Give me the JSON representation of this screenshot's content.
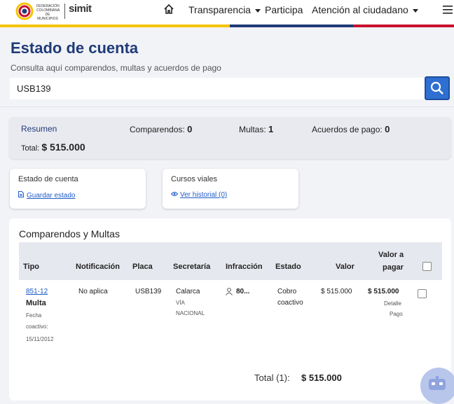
{
  "header": {
    "logo_text": "FEDERACIÓN COLOMBIANA DE MUNICIPIOS",
    "logo_simit": "simit",
    "nav": [
      "Transparencia",
      "Participa",
      "Atención al ciudadano"
    ],
    "flag_colors": [
      "#f5c400",
      "#1f3b78",
      "#c8102e"
    ]
  },
  "page": {
    "title": "Estado de cuenta",
    "subtitle": "Consulta aquí comparendos, multas y acuerdos de pago",
    "search_value": "USB139"
  },
  "summary": {
    "label": "Resumen",
    "comparendos_label": "Comparendos:",
    "comparendos_value": "0",
    "multas_label": "Multas:",
    "multas_value": "1",
    "acuerdos_label": "Acuerdos de pago:",
    "acuerdos_value": "0",
    "total_label": "Total:",
    "total_value": "$ 515.000"
  },
  "cards": [
    {
      "title": "Estado de cuenta",
      "link": "Guardar estado"
    },
    {
      "title": "Cursos viales",
      "link": "Ver historial (0)"
    }
  ],
  "table": {
    "title": "Comparendos y Multas",
    "headers": [
      "Tipo",
      "Notificación",
      "Placa",
      "Secretaría",
      "Infracción",
      "Estado",
      "Valor",
      "Valor a",
      "pagar"
    ],
    "row": {
      "numero": "851-12",
      "tipo": "Multa",
      "fecha_label": "Fecha",
      "fecha_label2": "coactivo:",
      "fecha": "15/11/2012",
      "notificacion": "No aplica",
      "placa": "USB139",
      "secretaria": "Calarca",
      "secretaria2": "VÍA",
      "secretaria3": "NACIONAL",
      "infraccion": "80...",
      "estado": "Cobro",
      "estado2": "coactivo",
      "valor": "$ 515.000",
      "valor_pagar": "$ 515.000",
      "detalle": "Detalle",
      "detalle2": "Pago"
    },
    "total_label": "Total (1):",
    "total_value": "$ 515.000"
  }
}
